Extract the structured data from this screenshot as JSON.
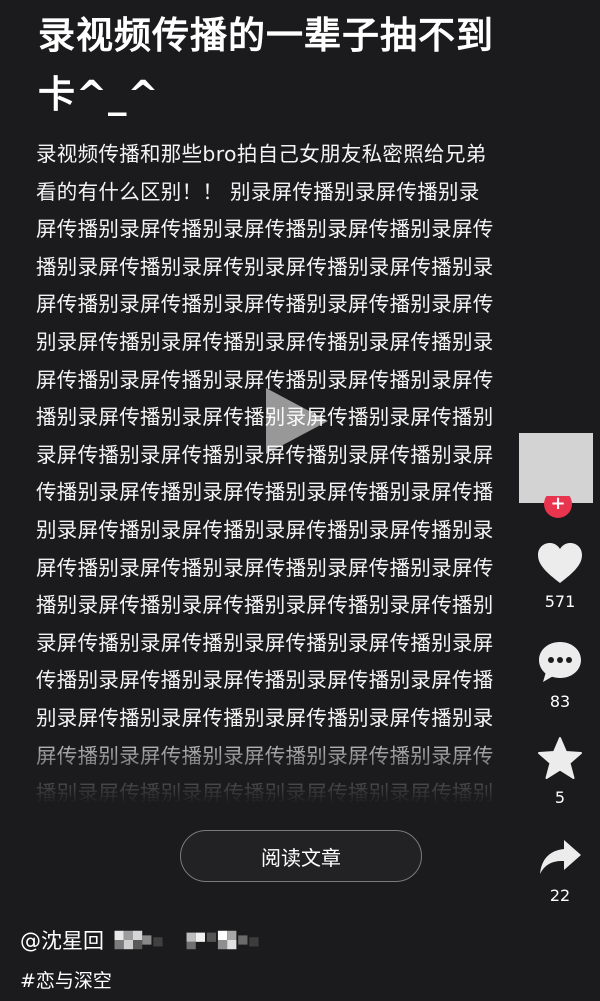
{
  "post": {
    "title": "录视频传播的一辈子抽不到卡^_^",
    "body": "录视频传播和那些bro拍自己女朋友私密照给兄弟看的有什么区别！！ 别录屏传播别录屏传播别录屏传播别录屏传播别录屏传播别录屏传播别录屏传播别录屏传播别录屏传别录屏传播别录屏传播别录屏传播别录屏传播别录屏传播别录屏传播别录屏传别录屏传播别录屏传播别录屏传播别录屏传播别录屏传播别录屏传播别录屏传播别录屏传播别录屏传播别录屏传播别录屏传播别录屏传播别录屏传播别录屏传播别录屏传播别录屏传播别录屏传播别录屏传播别录屏传播别录屏传播别录屏传播别录屏传播别录屏传播别录屏传播别录屏传播别录屏传播别录屏传播别录屏传播别录屏传播别录屏传播别录屏传播别录屏传播别录屏传播别录屏传播别录屏传播别录屏传播别录屏传播别录屏传播别录屏传播别录屏传播别录屏传播别录屏传播别录屏传播别录屏传播别录屏传播别录屏传播别录屏传播别录屏传播别录屏传播别录屏传播别录屏传播别录屏传播别录屏传播别录屏传播别录屏传播别录屏传播别录屏传播别录屏",
    "read_button": "阅读文章",
    "author": "@沈星回",
    "hashtag": "#恋与深空"
  },
  "actions": {
    "follow_symbol": "+",
    "like_count": "571",
    "comment_count": "83",
    "favorite_count": "5",
    "share_count": "22"
  },
  "icons": {
    "play": "play-icon",
    "follow": "plus-icon",
    "like": "heart-icon",
    "comment": "comment-icon",
    "favorite": "star-icon",
    "share": "share-icon"
  },
  "colors": {
    "background": "#1b1b1d",
    "follow_badge": "#e8344f",
    "avatar_placeholder": "#d3d3d3"
  }
}
